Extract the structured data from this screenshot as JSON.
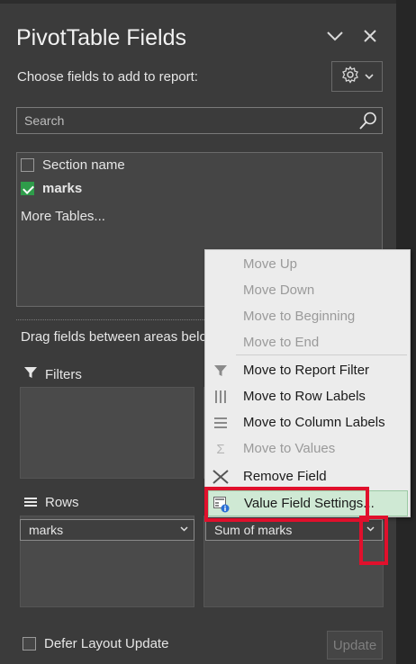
{
  "panel": {
    "title": "PivotTable Fields",
    "choose_label": "Choose fields to add to report:",
    "search_placeholder": "Search",
    "fields": [
      {
        "label": "Section name",
        "checked": false
      },
      {
        "label": "marks",
        "checked": true
      }
    ],
    "more_tables": "More Tables...",
    "drag_label": "Drag fields between areas below:"
  },
  "areas": {
    "filters": {
      "label": "Filters"
    },
    "rows": {
      "label": "Rows",
      "field": "marks"
    },
    "values": {
      "field": "Sum of marks"
    }
  },
  "footer": {
    "defer_label": "Defer Layout Update",
    "update_label": "Update"
  },
  "context_menu": {
    "items": [
      {
        "label": "Move Up",
        "enabled": false,
        "icon": "none"
      },
      {
        "label": "Move Down",
        "enabled": false,
        "icon": "none"
      },
      {
        "label": "Move to Beginning",
        "enabled": false,
        "icon": "none"
      },
      {
        "label": "Move to End",
        "enabled": false,
        "icon": "none"
      },
      {
        "label": "Move to Report Filter",
        "enabled": true,
        "icon": "filter-icon"
      },
      {
        "label": "Move to Row Labels",
        "enabled": true,
        "icon": "row-labels-icon"
      },
      {
        "label": "Move to Column Labels",
        "enabled": true,
        "icon": "column-labels-icon"
      },
      {
        "label": "Move to Values",
        "enabled": false,
        "icon": "sigma-icon"
      },
      {
        "label": "Remove Field",
        "enabled": true,
        "icon": "remove-x-icon"
      },
      {
        "label": "Value Field Settings...",
        "enabled": true,
        "icon": "value-field-settings-icon",
        "highlighted": true
      }
    ]
  },
  "colors": {
    "pane_bg": "#3b3b3b",
    "menu_bg": "#ececec",
    "highlight": "#cfe9d4",
    "annotation_red": "#e0102c",
    "check_green": "#2e9c4a"
  }
}
